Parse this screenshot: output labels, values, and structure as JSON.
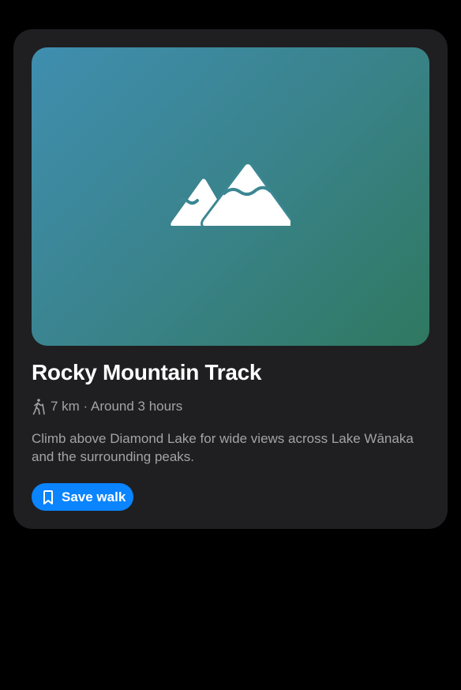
{
  "card": {
    "hero_icon": "mountains-icon",
    "title": "Rocky Mountain Track",
    "meta_icon": "hiking-person-icon",
    "meta_text": "7 km · Around 3 hours",
    "description": "Climb above Diamond Lake for wide views across Lake Wānaka and the surrounding peaks.",
    "save_button": {
      "icon": "bookmark-icon",
      "label": "Save walk"
    }
  },
  "colors": {
    "background": "#000000",
    "card": "#1f1f21",
    "accent": "#0a84ff",
    "hero_gradient_start": "#3f8eaf",
    "hero_gradient_end": "#2f7860",
    "secondary_text": "#a3a3a8"
  }
}
